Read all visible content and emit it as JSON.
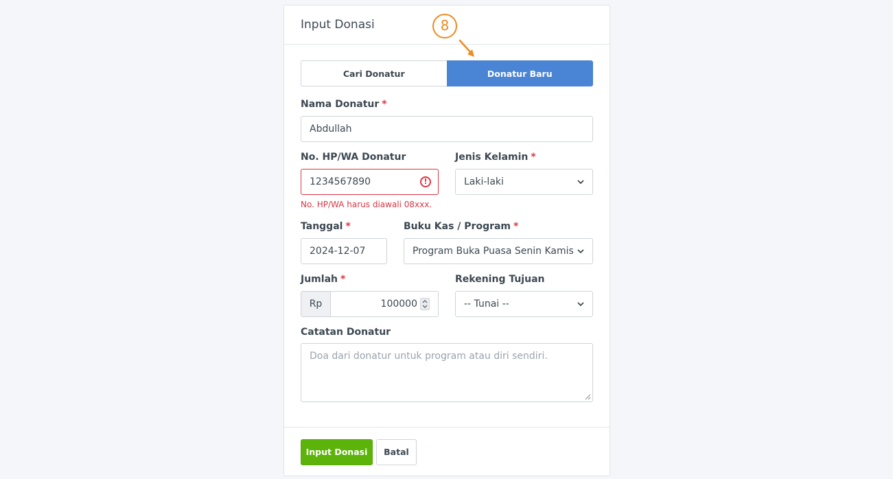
{
  "card": {
    "title": "Input Donasi",
    "annotation_number": "8"
  },
  "tabs": {
    "search_label": "Cari Donatur",
    "new_label": "Donatur Baru"
  },
  "form": {
    "name": {
      "label": "Nama Donatur",
      "value": "Abdullah"
    },
    "phone": {
      "label": "No. HP/WA Donatur",
      "value": "1234567890",
      "error": "No. HP/WA harus diawali 08xxx."
    },
    "gender": {
      "label": "Jenis Kelamin",
      "value": "Laki-laki"
    },
    "date": {
      "label": "Tanggal",
      "value": "2024-12-07"
    },
    "program": {
      "label": "Buku Kas / Program",
      "value": "Program Buka Puasa Senin Kamis"
    },
    "amount": {
      "label": "Jumlah",
      "prefix": "Rp",
      "value": "100000"
    },
    "account": {
      "label": "Rekening Tujuan",
      "value": "-- Tunai --"
    },
    "notes": {
      "label": "Catatan Donatur",
      "placeholder": "Doa dari donatur untuk program atau diri sendiri."
    },
    "required_mark": "*"
  },
  "footer": {
    "submit_label": "Input Donasi",
    "cancel_label": "Batal"
  },
  "colors": {
    "primary_blue": "#4a84d4",
    "success_green": "#5cb30a",
    "danger_red": "#dc3545",
    "annotation_orange": "#f08a1c"
  }
}
